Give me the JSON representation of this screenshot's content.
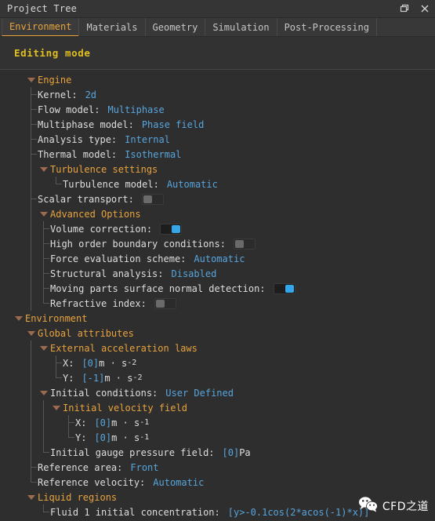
{
  "window": {
    "title": "Project Tree",
    "buttons": [
      {
        "name": "restore-button",
        "label": "❐"
      },
      {
        "name": "close-button",
        "label": "×"
      }
    ]
  },
  "tabs": [
    {
      "label": "Environment",
      "active": true
    },
    {
      "label": "Materials",
      "active": false
    },
    {
      "label": "Geometry",
      "active": false
    },
    {
      "label": "Simulation",
      "active": false
    },
    {
      "label": "Post-Processing",
      "active": false
    }
  ],
  "mode": {
    "label": "Editing mode"
  },
  "colors": {
    "accent": "#e8a33d",
    "value": "#57a5dd",
    "mode": "#e0c020",
    "toggle_on": "#35a7e8",
    "toggle_off": "#6a6a6a",
    "background": "#2e2e2e"
  },
  "tree": [
    {
      "id": "engine",
      "label": "Engine",
      "kind": "group",
      "caret": "open"
    },
    {
      "id": "kernel",
      "label": "Kernel:",
      "kind": "value",
      "value": "2d"
    },
    {
      "id": "flow-model",
      "label": "Flow model:",
      "kind": "value",
      "value": "Multiphase"
    },
    {
      "id": "multiphase",
      "label": "Multiphase model:",
      "kind": "value",
      "value": "Phase field"
    },
    {
      "id": "analysis-type",
      "label": "Analysis type:",
      "kind": "value",
      "value": "Internal"
    },
    {
      "id": "thermal-model",
      "label": "Thermal model:",
      "kind": "value",
      "value": "Isothermal"
    },
    {
      "id": "turb-settings",
      "label": "Turbulence settings",
      "kind": "group",
      "caret": "open"
    },
    {
      "id": "turb-model",
      "label": "Turbulence model:",
      "kind": "value",
      "value": "Automatic"
    },
    {
      "id": "scalar-transport",
      "label": "Scalar transport:",
      "kind": "toggle",
      "state": "off"
    },
    {
      "id": "advanced",
      "label": "Advanced Options",
      "kind": "group",
      "caret": "open"
    },
    {
      "id": "volume-corr",
      "label": "Volume correction:",
      "kind": "toggle",
      "state": "on"
    },
    {
      "id": "high-order-bc",
      "label": "High order boundary conditions:",
      "kind": "toggle",
      "state": "off"
    },
    {
      "id": "force-eval",
      "label": "Force evaluation scheme:",
      "kind": "value",
      "value": "Automatic"
    },
    {
      "id": "structural",
      "label": "Structural analysis:",
      "kind": "value",
      "value": "Disabled"
    },
    {
      "id": "moving-parts",
      "label": "Moving parts surface normal detection:",
      "kind": "toggle",
      "state": "on"
    },
    {
      "id": "refractive",
      "label": "Refractive index:",
      "kind": "toggle",
      "state": "off"
    },
    {
      "id": "environment",
      "label": "Environment",
      "kind": "group",
      "caret": "open"
    },
    {
      "id": "global-attrs",
      "label": "Global attributes",
      "kind": "group",
      "caret": "open"
    },
    {
      "id": "ext-accel",
      "label": "External acceleration laws",
      "kind": "group",
      "caret": "open"
    },
    {
      "id": "accel-x",
      "label": "X:",
      "kind": "unit",
      "value": "[0]",
      "unit": "m · s",
      "exp": "-2"
    },
    {
      "id": "accel-y",
      "label": "Y:",
      "kind": "unit",
      "value": "[-1]",
      "unit": "m · s",
      "exp": "-2"
    },
    {
      "id": "init-cond",
      "label": "Initial conditions:",
      "kind": "group-value",
      "caret": "open",
      "value": "User Defined"
    },
    {
      "id": "init-vel",
      "label": "Initial velocity field",
      "kind": "group",
      "caret": "open"
    },
    {
      "id": "vel-x",
      "label": "X:",
      "kind": "unit",
      "value": "[0]",
      "unit": "m · s",
      "exp": "-1"
    },
    {
      "id": "vel-y",
      "label": "Y:",
      "kind": "unit",
      "value": "[0]",
      "unit": "m · s",
      "exp": "-1"
    },
    {
      "id": "gauge-press",
      "label": "Initial gauge pressure field:",
      "kind": "unit",
      "value": "[0]",
      "unit": "Pa",
      "exp": ""
    },
    {
      "id": "ref-area",
      "label": "Reference area:",
      "kind": "value",
      "value": "Front"
    },
    {
      "id": "ref-velocity",
      "label": "Reference velocity:",
      "kind": "value",
      "value": "Automatic"
    },
    {
      "id": "liquid-regions",
      "label": "Liquid regions",
      "kind": "group",
      "caret": "open"
    },
    {
      "id": "fluid1-conc",
      "label": "Fluid 1 initial concentration:",
      "kind": "value",
      "value": "[y>-0.1cos(2*acos(-1)*x)]"
    }
  ],
  "watermark": {
    "text": "CFD之道"
  }
}
